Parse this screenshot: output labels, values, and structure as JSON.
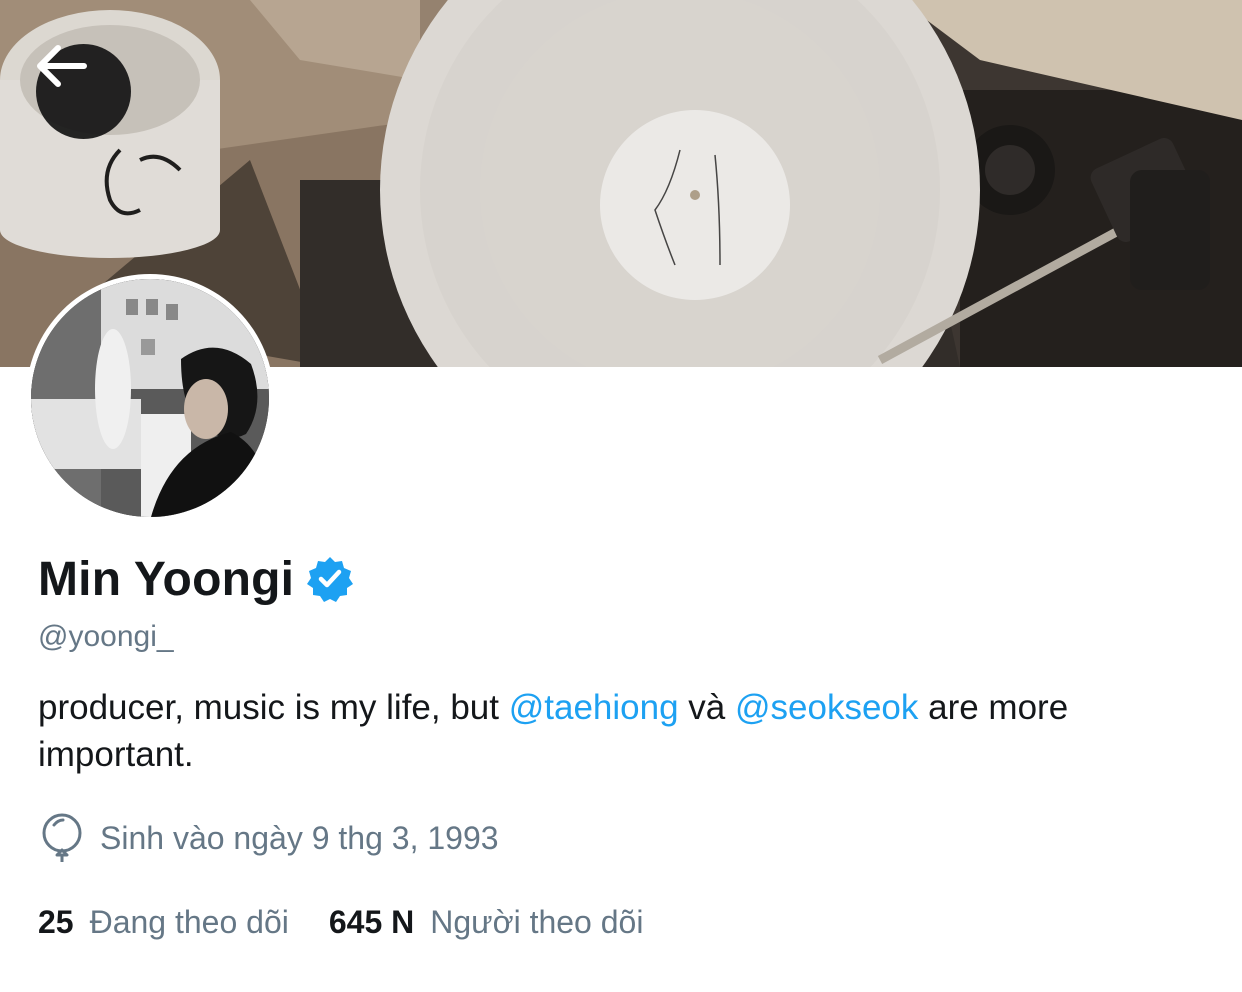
{
  "header": {
    "back_icon": "arrow-left-icon"
  },
  "profile": {
    "display_name": "Min Yoongi",
    "verified_icon": "verified-badge-icon",
    "verified_color": "#1da1f2",
    "handle": "@yoongi_",
    "bio": {
      "part1": "producer, music is my life, but ",
      "mention1": "@taehiong",
      "part2": " và ",
      "mention2": "@seokseok",
      "part3": " are more important."
    },
    "birthday": {
      "icon": "balloon-icon",
      "text": "Sinh vào ngày 9 thg 3, 1993"
    },
    "stats": {
      "following_count": "25",
      "following_label": "Đang theo dõi",
      "followers_count": "645 N",
      "followers_label": "Người theo dõi"
    }
  },
  "colors": {
    "accent": "#1da1f2",
    "text_primary": "#14171a",
    "text_secondary": "#657786"
  }
}
